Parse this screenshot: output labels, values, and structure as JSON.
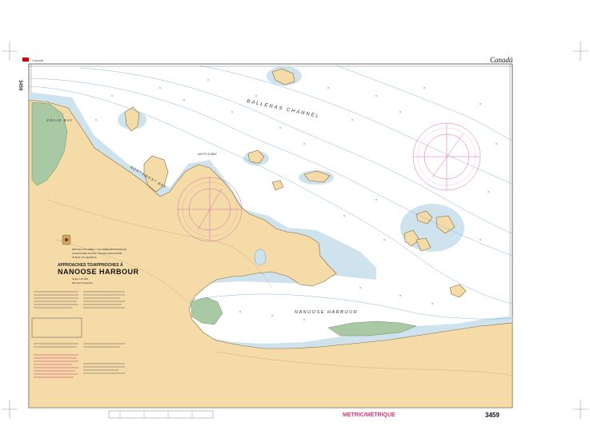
{
  "header": {
    "agency": "Canada",
    "wordmark": "Canadä",
    "chart_number": "3459",
    "chart_number_side": "3459"
  },
  "title_block": {
    "region": "BRITISH COLUMBIA / COLOMBIE-BRITANNIQUE",
    "subregion": "VANCOUVER ISLAND / ÎLE DE VANCOUVER",
    "strait": "STRAIT OF GEORGIA",
    "title_line1": "APPROACHES TO/APPROCHES À",
    "title_line2": "NANOOSE HARBOUR",
    "scale": "Scale 1:15 000",
    "projection": "Mercator Projection"
  },
  "place_names": {
    "ballenas_channel": "BALLENAS CHANNEL",
    "craig_bay": "CRAIG BAY",
    "northwest_bay": "NORTHWEST BAY",
    "nanoose_harbour": "NANOOSE HARBOUR",
    "wittys_bay": "WITTYS BAY"
  },
  "footer": {
    "metric": "METRIC/MÉTRIQUE",
    "chart_number": "3459"
  },
  "colors": {
    "land": "#f4dba8",
    "shallow": "#cfe3ef",
    "drying": "#a9c9a4",
    "magenta": "#d46ab0",
    "ink": "#333333"
  }
}
